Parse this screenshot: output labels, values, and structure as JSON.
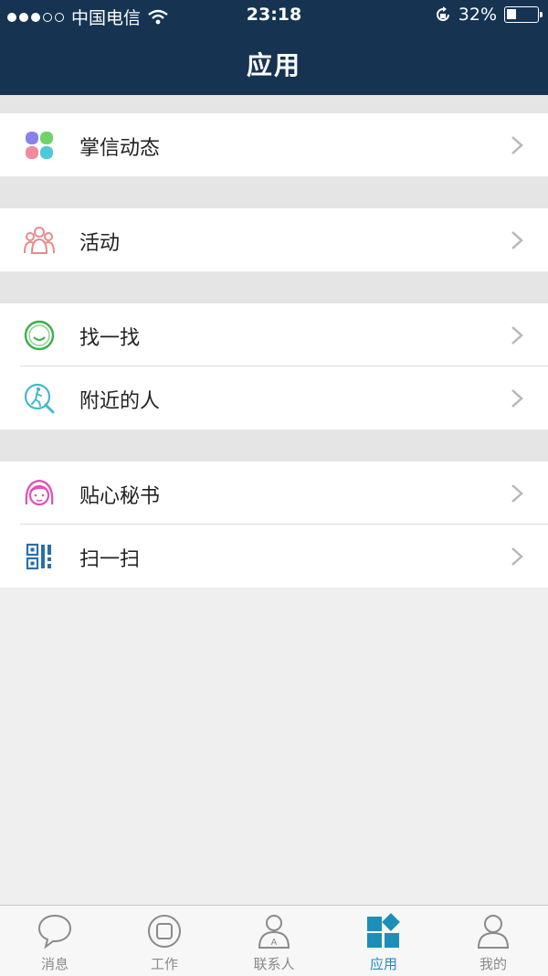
{
  "status_bar": {
    "carrier": "中国电信",
    "time": "23:18",
    "battery_percent": "32%",
    "battery_level": 0.32
  },
  "header": {
    "title": "应用"
  },
  "groups": [
    {
      "items": [
        {
          "label": "掌信动态",
          "icon": "four-dots-icon"
        }
      ]
    },
    {
      "items": [
        {
          "label": "活动",
          "icon": "people-group-icon"
        }
      ]
    },
    {
      "items": [
        {
          "label": "找一找",
          "icon": "smiley-icon"
        },
        {
          "label": "附近的人",
          "icon": "nearby-search-icon"
        }
      ]
    },
    {
      "items": [
        {
          "label": "贴心秘书",
          "icon": "girl-face-icon"
        },
        {
          "label": "扫一扫",
          "icon": "qr-code-icon"
        }
      ]
    }
  ],
  "tabbar": {
    "tabs": [
      {
        "label": "消息",
        "icon": "chat-bubble-icon"
      },
      {
        "label": "工作",
        "icon": "work-circle-icon"
      },
      {
        "label": "联系人",
        "icon": "contact-icon"
      },
      {
        "label": "应用",
        "icon": "apps-grid-icon",
        "active": true
      },
      {
        "label": "我的",
        "icon": "person-icon"
      }
    ]
  },
  "colors": {
    "header_bg": "#163452",
    "accent": "#1c8fb8"
  }
}
